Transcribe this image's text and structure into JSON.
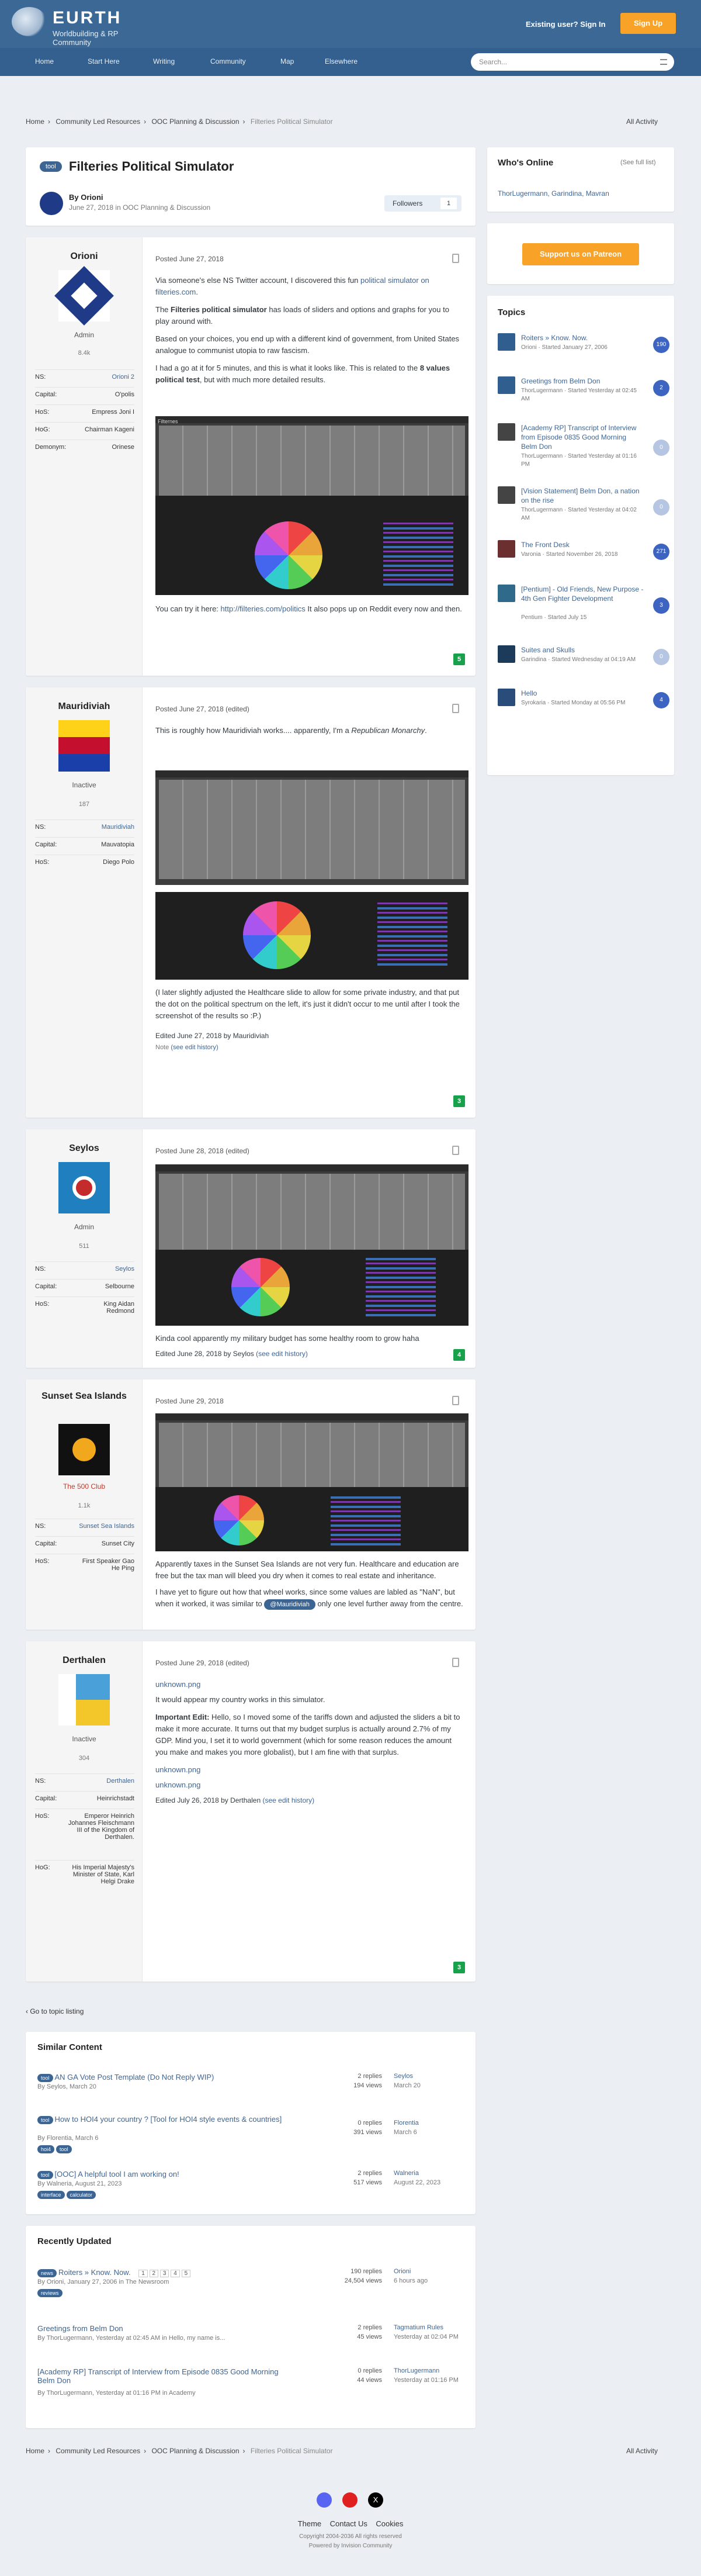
{
  "site": {
    "name": "EURTH",
    "subtitle": "Worldbuilding & RP Community",
    "signin": "Existing user? Sign In",
    "signup": "Sign Up",
    "search_placeholder": "Search..."
  },
  "nav": [
    {
      "label": "Home"
    },
    {
      "label": "Start Here"
    },
    {
      "label": "Writing"
    },
    {
      "label": "Community"
    },
    {
      "label": "Map"
    },
    {
      "label": "Elsewhere"
    }
  ],
  "breadcrumb": [
    "Home",
    "Community Led Resources",
    "OOC Planning & Discussion",
    "Filteries Political Simulator"
  ],
  "all_activity": "All Activity",
  "topic": {
    "badge": "tool",
    "title": "Filteries Political Simulator",
    "by": "By Orioni",
    "date": "June 27, 2018 in OOC Planning & Discussion",
    "followers_label": "Followers",
    "followers_count": "1"
  },
  "online": {
    "title": "Who's Online",
    "see_full": "(See full list)",
    "users": "ThorLugermann, Garindina, Mavran"
  },
  "patreon": "Support us on Patreon",
  "topics_widget": {
    "title": "Topics",
    "items": [
      {
        "title": "Roiters » Know. Now.",
        "meta": "Orioni · Started January 27, 2006",
        "count": "190",
        "color": "#2d4f86"
      },
      {
        "title": "Greetings from Belm Don",
        "meta": "ThorLugermann · Started Yesterday at 02:45 AM",
        "count": "2",
        "color": "#3a5c8a"
      },
      {
        "title": "[Academy RP] Transcript of Interview from Episode 0835 Good Morning Belm Don",
        "meta": "ThorLugermann · Started Yesterday at 01:16 PM",
        "count": "0",
        "color": "#444"
      },
      {
        "title": "[Vision Statement] Belm Don, a nation on the rise",
        "meta": "ThorLugermann · Started Yesterday at 04:02 AM",
        "count": "0",
        "color": "#444"
      },
      {
        "title": "The Front Desk",
        "meta": "Varonia · Started November 26, 2018",
        "count": "271",
        "color": "#6b2f2f"
      },
      {
        "title": "[Pentium] - Old Friends, New Purpose - 4th Gen Fighter Development",
        "meta": "Pentium · Started July 15",
        "count": "3",
        "color": "#2f6a8a"
      },
      {
        "title": "Suites and Skulls",
        "meta": "Garindina · Started Wednesday at 04:19 AM",
        "count": "0",
        "color": "#1c3a5a"
      },
      {
        "title": "Hello",
        "meta": "Syrokaria · Started Monday at 05:56 PM",
        "count": "4",
        "color": "#2a4c7a"
      }
    ]
  },
  "posts": [
    {
      "author": "Orioni",
      "role": "Admin",
      "count": "8.4k",
      "fields": [
        [
          "NS:",
          "Orioni 2"
        ],
        [
          "Capital:",
          "O'polis"
        ],
        [
          "HoS:",
          "Empress Joni I"
        ],
        [
          "HoG:",
          "Chairman Kageni"
        ],
        [
          "Demonym:",
          "Orinese"
        ]
      ],
      "date": "Posted June 27, 2018",
      "rep": "5",
      "p1a": "Via someone's else NS Twitter account, I discovered this fun ",
      "p1link": "political simulator on filteries.com",
      "p1b": ".",
      "p2a": "The ",
      "p2b": "Filteries political simulator",
      "p2c": " has loads of sliders and options and graphs for you to play around with.",
      "p3": "Based on your choices, you end up with a different kind of government, from United States analogue to communist utopia to raw fascism.",
      "p4a": "I had a go at it for 5 minutes, and this is what it looks like. This is related to the ",
      "p4b": "8 values political test",
      "p4c": ", but with much more detailed results.",
      "p5a": "You can try it here: ",
      "p5link": "http://filteries.com/politics",
      "p5b": " It also pops up on Reddit every now and then.",
      "shot_title": "Filternes"
    },
    {
      "author": "Mauridiviah",
      "role": "Inactive",
      "count": "187",
      "fields": [
        [
          "NS:",
          "Mauridiviah"
        ],
        [
          "Capital:",
          "Mauvatopia"
        ],
        [
          "HoS:",
          "Diego Polo"
        ]
      ],
      "date": "Posted June 27, 2018 (edited)",
      "rep": "3",
      "p1a": "This is roughly how Mauridiviah works.... apparently, I'm a ",
      "p1b": "Republican Monarchy",
      "p1c": ".",
      "p2": "(I later slightly adjusted the Healthcare slide to allow for some private industry, and that put the dot on the political spectrum on the left, it's just it didn't occur to me until after I took the screenshot of the results so :P.)",
      "edited": "Edited June 27, 2018 by Mauridiviah",
      "note": "Note",
      "history": "(see edit history)"
    },
    {
      "author": "Seylos",
      "role": "Admin",
      "count": "511",
      "fields": [
        [
          "NS:",
          "Seylos"
        ],
        [
          "Capital:",
          "Selbourne"
        ],
        [
          "HoS:",
          "King Aidan Redmond"
        ]
      ],
      "date": "Posted June 28, 2018 (edited)",
      "rep": "4",
      "p1": "Kinda cool apparently my military budget has some healthy room to grow haha",
      "edited": "Edited June 28, 2018 by Seylos",
      "history": "(see edit history)"
    },
    {
      "author": "Sunset Sea Islands",
      "role": "The 500 Club",
      "count": "1.1k",
      "fields": [
        [
          "NS:",
          "Sunset Sea Islands"
        ],
        [
          "Capital:",
          "Sunset City"
        ],
        [
          "HoS:",
          "First Speaker Gao He Ping"
        ]
      ],
      "date": "Posted June 29, 2018",
      "p1": "Apparently taxes in the Sunset Sea Islands are not very fun. Healthcare and education are free but the tax man will bleed you dry when it comes to real estate and inheritance.",
      "p2a": "I have yet to figure out how that wheel works, since some values are labled as \"NaN\", but when it worked, it was similar to ",
      "mention": "@Mauridiviah",
      "p2b": " only one level further away from the centre."
    },
    {
      "author": "Derthalen",
      "role": "Inactive",
      "count": "304",
      "fields": [
        [
          "NS:",
          "Derthalen"
        ],
        [
          "Capital:",
          "Heinrichstadt"
        ],
        [
          "HoS:",
          "Emperor Heinrich Johannes Fleischmann III of the Kingdom of Derthalen."
        ],
        [
          "HoG:",
          "His Imperial Majesty's Minister of State, Karl Helgi Drake"
        ]
      ],
      "date": "Posted June 29, 2018 (edited)",
      "rep": "3",
      "img1": "unknown.png",
      "p1": "It would appear my country works in this simulator.",
      "p2a": "Important Edit:",
      "p2b": " Hello, so I moved some of the tariffs down and adjusted the sliders a bit to make it more accurate. It turns out that my budget surplus is actually around 2.7% of my GDP. Mind you, I set it to world government (which for some reason reduces the amount you make and makes you more globalist), but I am fine with that surplus.",
      "img2": "unknown.png",
      "img3": "unknown.png",
      "edited": "Edited July 26, 2018 by Derthalen",
      "history": "(see edit history)"
    }
  ],
  "goto_listing": "Go to topic listing",
  "similar": {
    "title": "Similar Content",
    "rows": [
      {
        "badge": "tool",
        "title": "AN GA Vote Post Template (Do Not Reply WIP)",
        "meta": "By Seylos, March 20",
        "replies": "2 replies",
        "views": "194 views",
        "lp": "Seylos",
        "lpd": "March 20"
      },
      {
        "badge": "tool",
        "title": "How to HOI4 your country ? [Tool for HOI4 style events & countries]",
        "meta": "By Florentia, March 6",
        "tags": [
          "hoi4",
          "tool"
        ],
        "replies": "0 replies",
        "views": "391 views",
        "lp": "Florentia",
        "lpd": "March 6"
      },
      {
        "badge": "tool",
        "title": "[OOC] A helpful tool I am working on!",
        "meta": "By Walneria, August 21, 2023",
        "tags": [
          "interface",
          "calculator"
        ],
        "replies": "2 replies",
        "views": "517 views",
        "lp": "Walneria",
        "lpd": "August 22, 2023"
      }
    ]
  },
  "recent": {
    "title": "Recently Updated",
    "rows": [
      {
        "badge": "news",
        "title": "Roiters » Know. Now.",
        "pages": [
          "1",
          "2",
          "3",
          "4",
          "5"
        ],
        "meta": "By Orioni, January 27, 2006 in The Newsroom",
        "tags": [
          "reviews"
        ],
        "replies": "190 replies",
        "views": "24,504 views",
        "lp": "Orioni",
        "lpd": "6 hours ago"
      },
      {
        "title": "Greetings from Belm Don",
        "meta": "By ThorLugermann, Yesterday at 02:45 AM in Hello, my name is...",
        "replies": "2 replies",
        "views": "45 views",
        "lp": "Tagmatium Rules",
        "lpd": "Yesterday at 02:04 PM"
      },
      {
        "title": "[Academy RP] Transcript of Interview from Episode 0835 Good Morning Belm Don",
        "meta": "By ThorLugermann, Yesterday at 01:16 PM in Academy",
        "replies": "0 replies",
        "views": "44 views",
        "lp": "ThorLugermann",
        "lpd": "Yesterday at 01:16 PM"
      }
    ]
  },
  "footer": {
    "links": [
      "Theme",
      "Contact Us",
      "Cookies"
    ],
    "copyright": "Copyright 2004-2036 All rights reserved",
    "powered": "Powered by Invision Community"
  }
}
